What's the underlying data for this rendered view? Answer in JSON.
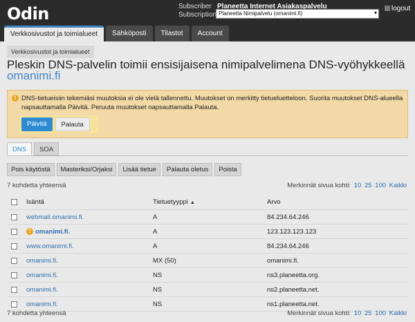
{
  "app": {
    "logo": "Odin"
  },
  "header": {
    "subscriber_label": "Subscriber",
    "subscriber_value": "Planeetta Internet Asiakaspalvelu",
    "subscription_label": "Subscription",
    "subscription_value": "Planeetta Nimipalvelu (omanimi.fi)",
    "logout": "logout"
  },
  "tabs": [
    {
      "label": "Verkkosivustot ja toimialueet",
      "active": true
    },
    {
      "label": "Sähköposti"
    },
    {
      "label": "Tilastot"
    },
    {
      "label": "Account"
    }
  ],
  "breadcrumb": "Verkkosivustot ja toimialueet",
  "page": {
    "title": "Pleskin DNS-palvelin toimii ensisijaisena nimipalvelimena DNS-vyöhykkeellä",
    "domain": "omanimi.fi"
  },
  "warning": {
    "text": "DNS-tietueisiin tekemiäsi muutoksia ei ole vielä tallennettu. Muutokset on merkitty tietueluetteloon. Suorita muutokset DNS-alueella napsauttamalla Päivitä. Peruuta muutokset napsauttamalla Palauta.",
    "update_label": "Päivitä",
    "revert_label": "Palauta"
  },
  "subtabs": [
    {
      "label": "DNS",
      "active": true
    },
    {
      "label": "SOA"
    }
  ],
  "toolbar": {
    "disable": "Pois käytöstä",
    "master_slave": "Masteriksi/Orjaksi",
    "add_record": "Lisää tietue",
    "restore_defaults": "Palauta oletus",
    "remove": "Poista"
  },
  "list": {
    "total_text": "7 kohdetta yhteensä",
    "per_page_label": "Merkinnät sivua kohti:",
    "per_page_options": [
      "10",
      "25",
      "100",
      "Kaikki"
    ],
    "columns": {
      "host": "Isäntä",
      "type": "Tietuetyyppi",
      "value": "Arvo"
    },
    "rows": [
      {
        "host": "webmail.omanimi.fi.",
        "type": "A",
        "value": "84.234.64.246"
      },
      {
        "host": "omanimi.fi.",
        "type": "A",
        "value": "123.123.123.123",
        "modified": true
      },
      {
        "host": "www.omanimi.fi.",
        "type": "A",
        "value": "84.234.64.246"
      },
      {
        "host": "omanimi.fi.",
        "type": "MX (50)",
        "value": "omanimi.fi."
      },
      {
        "host": "omanimi.fi.",
        "type": "NS",
        "value": "ns3.planeetta.org."
      },
      {
        "host": "omanimi.fi.",
        "type": "NS",
        "value": "ns2.planeetta.net."
      },
      {
        "host": "omanimi.fi.",
        "type": "NS",
        "value": "ns1.planeetta.net."
      }
    ]
  },
  "colors": {
    "accent": "#2e8ad1",
    "warning_bg": "#f2d9a7",
    "topbar": "#2b2b2b"
  }
}
